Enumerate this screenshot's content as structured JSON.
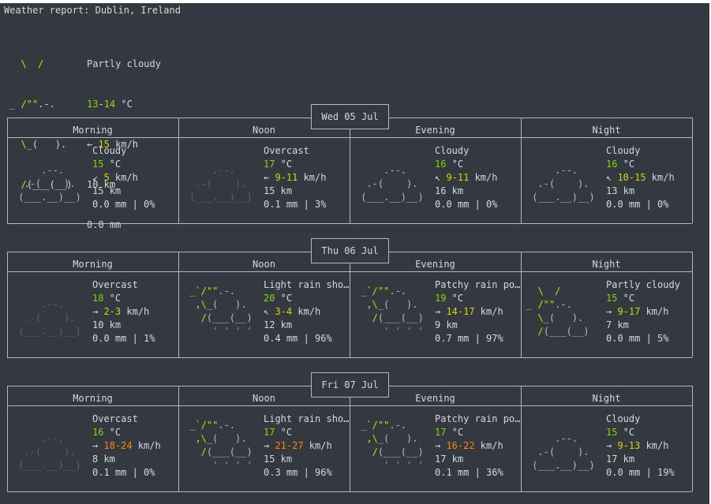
{
  "report": {
    "title": "Weather report: Dublin, Ireland",
    "current": {
      "art": [
        "  \\  /",
        "_ /\"\".-.",
        "  \\_(   ).",
        "  /(___(__)"
      ],
      "condition": "Partly cloudy",
      "temp_lo": "13",
      "temp_sep": "-",
      "temp_hi": "14",
      "temp_unit": " °C",
      "wind_arrow": "← ",
      "wind_speed": "15",
      "wind_unit": " km/h",
      "visibility": "10 km",
      "precip": "0.0 mm"
    }
  },
  "columns": [
    "Morning",
    "Noon",
    "Evening",
    "Night"
  ],
  "days": [
    {
      "date": "Wed 05 Jul",
      "slots": [
        {
          "art": "cloudy",
          "art_lines": [
            "",
            "     .--.",
            "  .-(    ).",
            " (___.__)__)"
          ],
          "condition": "Cloudy",
          "temp": "15",
          "temp_unit": " °C",
          "wind_arrow": "↙ ",
          "wind": "5",
          "wind_unit": " km/h",
          "visibility": "15 km",
          "precip": "0.0 mm | 0%"
        },
        {
          "art": "overcast",
          "art_lines": [
            "",
            "     .--.",
            "  .-(    ).",
            " (___.__)__)"
          ],
          "condition": "Overcast",
          "temp": "17",
          "temp_unit": " °C",
          "wind_arrow": "← ",
          "wind": "9-11",
          "wind_unit": " km/h",
          "visibility": "15 km",
          "precip": "0.1 mm | 3%"
        },
        {
          "art": "cloudy",
          "art_lines": [
            "",
            "     .--.",
            "  .-(    ).",
            " (___.__)__)"
          ],
          "condition": "Cloudy",
          "temp": "16",
          "temp_unit": " °C",
          "wind_arrow": "↖ ",
          "wind": "9-11",
          "wind_unit": " km/h",
          "visibility": "16 km",
          "precip": "0.0 mm | 0%"
        },
        {
          "art": "cloudy",
          "art_lines": [
            "",
            "     .--.",
            "  .-(    ).",
            " (___.__)__)"
          ],
          "condition": "Cloudy",
          "temp": "16",
          "temp_unit": " °C",
          "wind_arrow": "↖ ",
          "wind": "10-15",
          "wind_unit": " km/h",
          "visibility": "13 km",
          "precip": "0.0 mm | 0%"
        }
      ]
    },
    {
      "date": "Thu 06 Jul",
      "slots": [
        {
          "art": "overcast",
          "art_lines": [
            "",
            "     .--.",
            "  .-(    ).",
            " (___.__)__)"
          ],
          "condition": "Overcast",
          "temp": "18",
          "temp_unit": " °C",
          "wind_arrow": "→ ",
          "wind": "2-3",
          "wind_unit": " km/h",
          "visibility": "10 km",
          "precip": "0.0 mm | 1%"
        },
        {
          "art": "rain",
          "art_lines": [
            " _`/\"\".-.",
            "  ,\\_(   ).",
            "   /(___(__)",
            "     ‘ ‘ ‘ ‘"
          ],
          "condition": "Light rain sho…",
          "temp": "20",
          "temp_unit": " °C",
          "wind_arrow": "↖ ",
          "wind": "3-4",
          "wind_unit": " km/h",
          "visibility": "12 km",
          "precip": "0.4 mm | 96%"
        },
        {
          "art": "rain",
          "art_lines": [
            " _`/\"\".-.",
            "  ,\\_(   ).",
            "   /(___(__)",
            "     ‘ ‘ ‘ ‘"
          ],
          "condition": "Patchy rain po…",
          "temp": "19",
          "temp_unit": " °C",
          "wind_arrow": "→ ",
          "wind": "14-17",
          "wind_unit": " km/h",
          "visibility": "9 km",
          "precip": "0.7 mm | 97%"
        },
        {
          "art": "partly",
          "art_lines": [
            "  \\  /",
            "_ /\"\".-.",
            "  \\_(   ).",
            "  /(___(__)"
          ],
          "condition": "Partly cloudy",
          "temp": "15",
          "temp_unit": " °C",
          "wind_arrow": "→ ",
          "wind": "9-17",
          "wind_unit": " km/h",
          "visibility": "7 km",
          "precip": "0.0 mm | 5%"
        }
      ]
    },
    {
      "date": "Fri 07 Jul",
      "slots": [
        {
          "art": "overcast",
          "art_lines": [
            "",
            "     .--.",
            "  .-(    ).",
            " (___.__)__)"
          ],
          "condition": "Overcast",
          "temp": "16",
          "temp_unit": " °C",
          "wind_arrow": "→ ",
          "wind": "18-24",
          "wind_unit": " km/h",
          "visibility": "8 km",
          "precip": "0.1 mm | 0%"
        },
        {
          "art": "rain",
          "art_lines": [
            " _`/\"\".-.",
            "  ,\\_(   ).",
            "   /(___(__)",
            "     ‘ ‘ ‘ ‘"
          ],
          "condition": "Light rain sho…",
          "temp": "17",
          "temp_unit": " °C",
          "wind_arrow": "→ ",
          "wind": "21-27",
          "wind_unit": " km/h",
          "visibility": "15 km",
          "precip": "0.3 mm | 96%"
        },
        {
          "art": "rain",
          "art_lines": [
            " _`/\"\".-.",
            "  ,\\_(   ).",
            "   /(___(__)",
            "     ‘ ‘ ‘ ‘"
          ],
          "condition": "Patchy rain po…",
          "temp": "17",
          "temp_unit": " °C",
          "wind_arrow": "→ ",
          "wind": "16-22",
          "wind_unit": " km/h",
          "visibility": "17 km",
          "precip": "0.1 mm | 36%"
        },
        {
          "art": "cloudy",
          "art_lines": [
            "",
            "     .--.",
            "  .-(    ).",
            " (___.__)__)"
          ],
          "condition": "Cloudy",
          "temp": "15",
          "temp_unit": " °C",
          "wind_arrow": "→ ",
          "wind": "9-13",
          "wind_unit": " km/h",
          "visibility": "17 km",
          "precip": "0.0 mm | 19%"
        }
      ]
    }
  ],
  "colors": {
    "background": "#343841",
    "text": "#d6d8dc",
    "sun": "#d7d700",
    "temp_green": "#87d700",
    "wind_yellow": "#d7d700",
    "wind_orange": "#ff8700",
    "rain": "#5f87d7"
  }
}
